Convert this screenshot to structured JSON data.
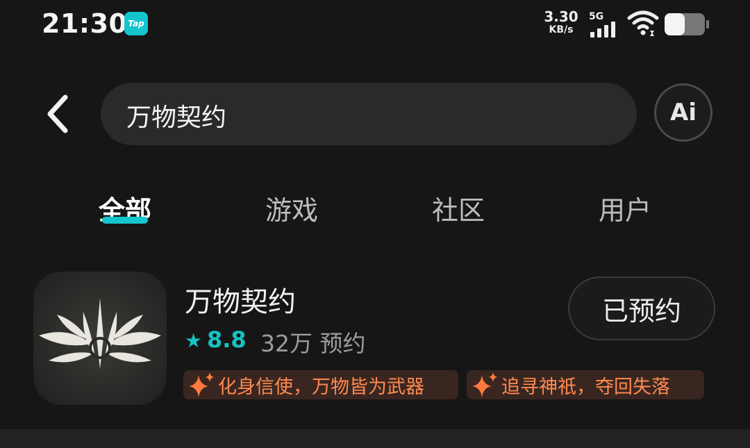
{
  "status_bar": {
    "time": "21:30",
    "app_badge": "Tap",
    "net_speed_value": "3.30",
    "net_speed_unit": "KB/s",
    "network_type": "5G",
    "battery_level": 0.5
  },
  "search": {
    "query": "万物契约",
    "ai_label": "Ai"
  },
  "tabs": [
    {
      "label": "全部",
      "active": true
    },
    {
      "label": "游戏",
      "active": false
    },
    {
      "label": "社区",
      "active": false
    },
    {
      "label": "用户",
      "active": false
    }
  ],
  "result": {
    "title": "万物契约",
    "rating": "8.8",
    "reservations": "32万 预约",
    "action_label": "已预约",
    "tags": [
      "化身信使，万物皆为武器",
      "追寻神祇，夺回失落"
    ]
  },
  "colors": {
    "accent": "#15c5ce",
    "tag_text": "#ff8a50",
    "background": "#161616"
  }
}
